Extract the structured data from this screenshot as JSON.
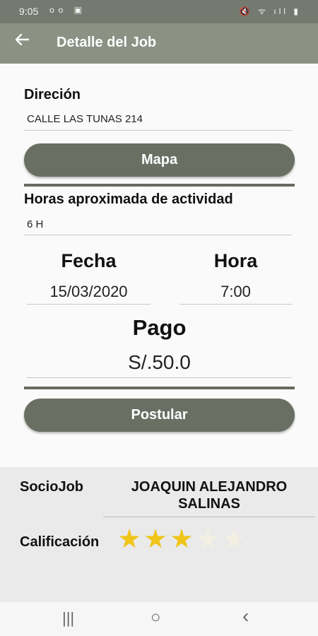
{
  "status": {
    "time": "9:05",
    "left_icons": "oo ▣",
    "right_icons": "🔇 ᯤ ıll ▮"
  },
  "appbar": {
    "title": "Detalle del Job"
  },
  "direccion": {
    "label": "Direción",
    "value": "CALLE LAS TUNAS 214"
  },
  "mapa_button": "Mapa",
  "horas": {
    "label": "Horas aproximada de actividad",
    "value": "6 H"
  },
  "fecha": {
    "label": "Fecha",
    "value": "15/03/2020"
  },
  "hora": {
    "label": "Hora",
    "value": "7:00"
  },
  "pago": {
    "label": "Pago",
    "value": "S/.50.0"
  },
  "postular_button": "Postular",
  "sociojob": {
    "label": "SocioJob",
    "value": "JOAQUIN ALEJANDRO SALINAS"
  },
  "calificacion": {
    "label": "Calificación",
    "rating": 3,
    "max": 5,
    "star_color": "#f0c419"
  },
  "navbar": {
    "recents": "|||",
    "home": "○",
    "back": "‹"
  }
}
